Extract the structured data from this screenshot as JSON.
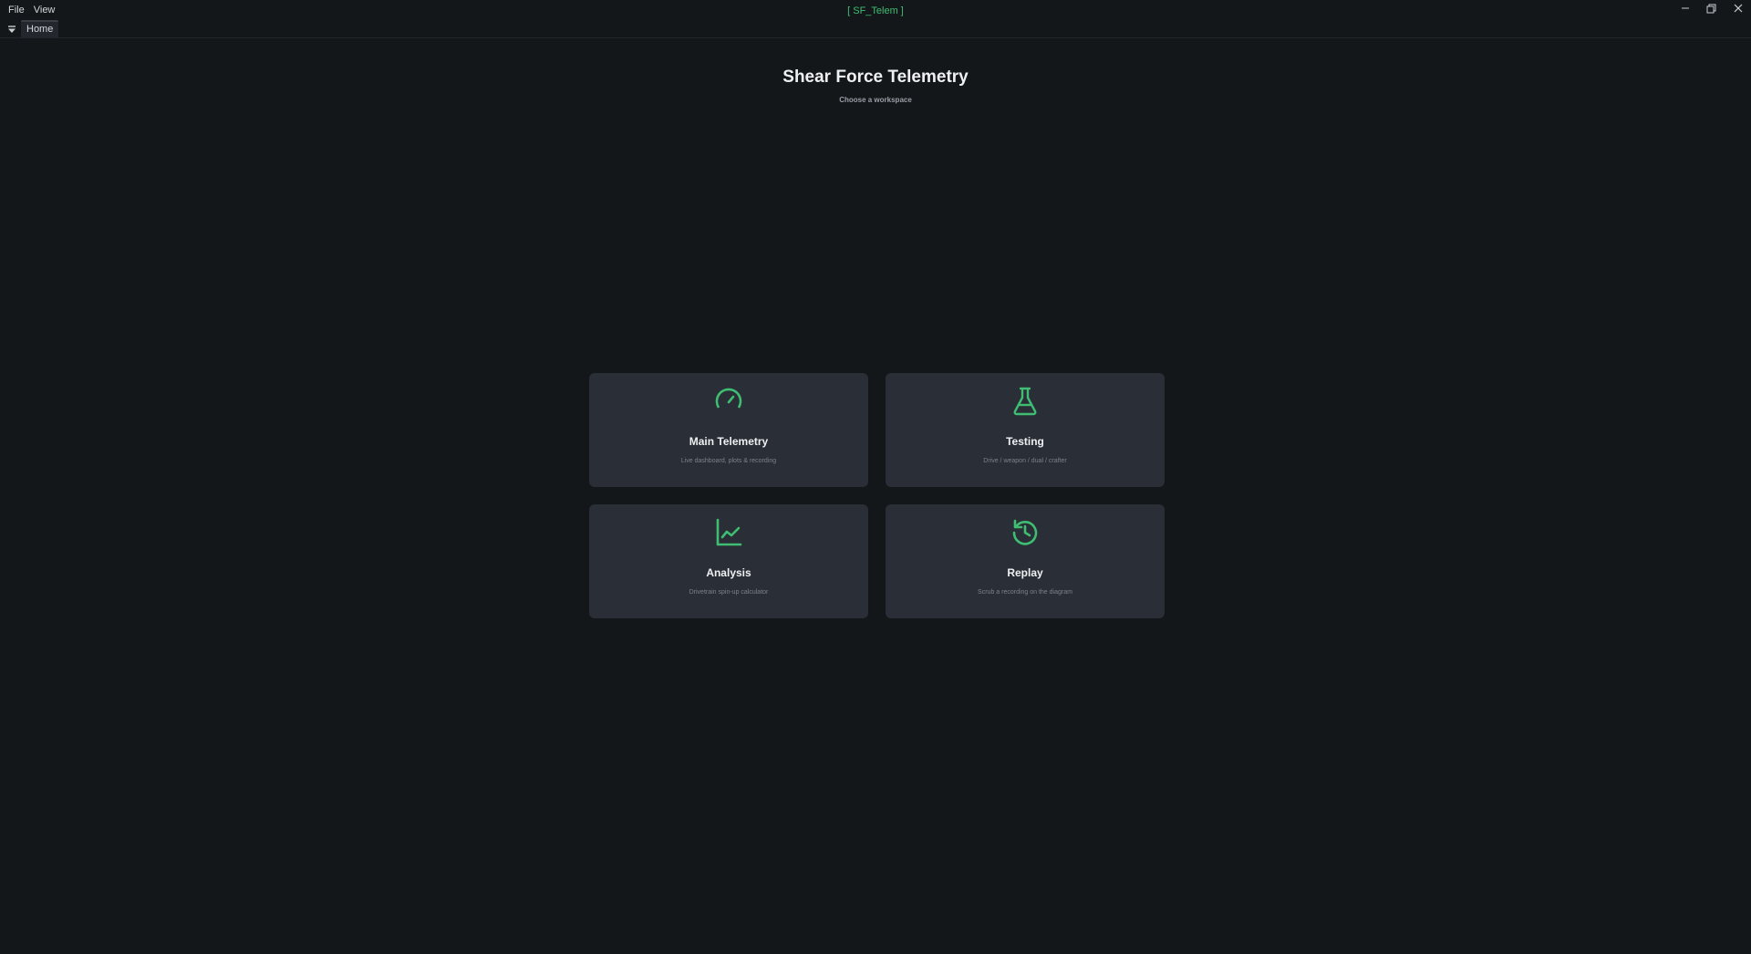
{
  "menu": {
    "file_label": "File",
    "view_label": "View"
  },
  "window": {
    "title": "[ SF_Telem ]"
  },
  "tabs": [
    {
      "label": "Home"
    }
  ],
  "home": {
    "title": "Shear Force Telemetry",
    "subtitle": "Choose a workspace"
  },
  "workspaces": [
    {
      "title": "Main Telemetry",
      "description": "Live dashboard, plots & recording",
      "icon": "gauge-icon"
    },
    {
      "title": "Testing",
      "description": "Drive / weapon / dual / crafter",
      "icon": "flask-icon"
    },
    {
      "title": "Analysis",
      "description": "Drivetrain spin-up calculator",
      "icon": "line-chart-icon"
    },
    {
      "title": "Replay",
      "description": "Scrub a recording on the diagram",
      "icon": "history-icon"
    }
  ],
  "colors": {
    "accent": "#3fbd72",
    "background": "#14171a",
    "card": "#2a2e36"
  }
}
